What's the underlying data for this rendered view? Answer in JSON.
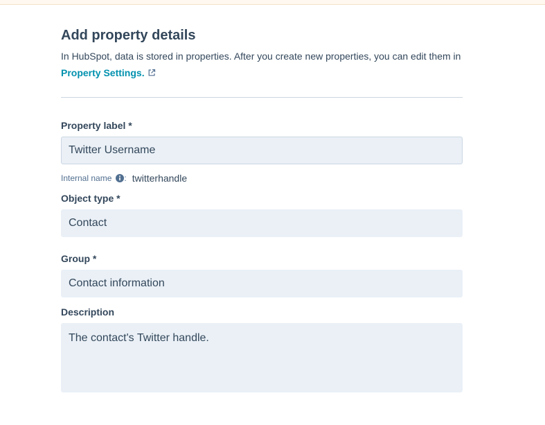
{
  "header": {
    "title": "Add property details",
    "intro_text": "In HubSpot, data is stored in properties. After you create new properties, you can edit them in",
    "settings_link": "Property Settings."
  },
  "fields": {
    "property_label": {
      "label": "Property label *",
      "value": "Twitter Username"
    },
    "internal_name": {
      "label": "Internal name",
      "separator": ":",
      "value": "twitterhandle"
    },
    "object_type": {
      "label": "Object type *",
      "value": "Contact"
    },
    "group": {
      "label": "Group *",
      "value": "Contact information"
    },
    "description": {
      "label": "Description",
      "value": "The contact's Twitter handle."
    }
  },
  "icons": {
    "external_link": "external-link-icon",
    "info": "info-icon"
  },
  "colors": {
    "text": "#33475b",
    "link": "#0091ae",
    "field_bg": "#eaf0f6",
    "divider": "#cbd6e2"
  }
}
